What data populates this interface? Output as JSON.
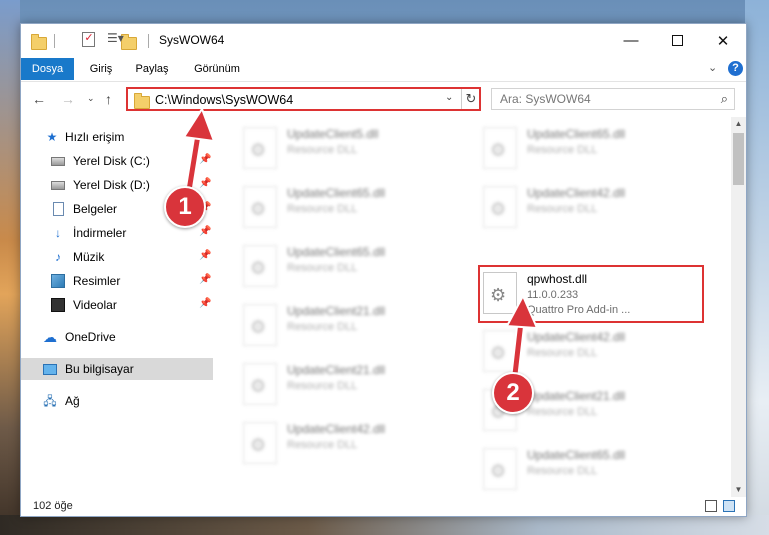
{
  "window": {
    "title": "SysWOW64"
  },
  "ribbon": {
    "tabs": [
      "Dosya",
      "Giriş",
      "Paylaş",
      "Görünüm"
    ]
  },
  "address": {
    "path": "C:\\Windows\\SysWOW64"
  },
  "search": {
    "placeholder": "Ara: SysWOW64"
  },
  "nav": {
    "items": [
      {
        "label": "Hızlı erişim",
        "icon": "star-icon"
      },
      {
        "label": "Yerel Disk (C:)",
        "icon": "disk-icon"
      },
      {
        "label": "Yerel Disk (D:)",
        "icon": "disk-icon"
      },
      {
        "label": "Belgeler",
        "icon": "documents-icon"
      },
      {
        "label": "İndirmeler",
        "icon": "download-icon"
      },
      {
        "label": "Müzik",
        "icon": "music-icon"
      },
      {
        "label": "Resimler",
        "icon": "pictures-icon"
      },
      {
        "label": "Videolar",
        "icon": "videos-icon"
      },
      {
        "label": "OneDrive",
        "icon": "cloud-icon"
      },
      {
        "label": "Bu bilgisayar",
        "icon": "computer-icon"
      },
      {
        "label": "Ağ",
        "icon": "network-icon"
      }
    ]
  },
  "files": [
    {
      "name": "UpdateClient5.dll",
      "line2": "Resource DLL"
    },
    {
      "name": "UpdateClient65.dll",
      "line2": "Resource DLL"
    },
    {
      "name": "UpdateClient65.dll",
      "line2": "Resource DLL"
    },
    {
      "name": "UpdateClient42.dll",
      "line2": "Resource DLL"
    },
    {
      "name": "UpdateClient65.dll",
      "line2": "Resource DLL"
    },
    {
      "name": "qpwhost.dll",
      "line2": "11.0.0.233",
      "line3": "Quattro Pro Add-in ..."
    },
    {
      "name": "UpdateClient21.dll",
      "line2": "Resource DLL"
    },
    {
      "name": "UpdateClient42.dll",
      "line2": "Resource DLL"
    },
    {
      "name": "UpdateClient21.dll",
      "line2": "Resource DLL"
    },
    {
      "name": "UpdateClient21.dll",
      "line2": "Resource DLL"
    },
    {
      "name": "UpdateClient42.dll",
      "line2": "Resource DLL"
    },
    {
      "name": "UpdateClient65.dll",
      "line2": "Resource DLL"
    }
  ],
  "status": {
    "count": "102 öğe"
  },
  "annotations": {
    "badge1": "1",
    "badge2": "2",
    "color": "#d9343b"
  }
}
